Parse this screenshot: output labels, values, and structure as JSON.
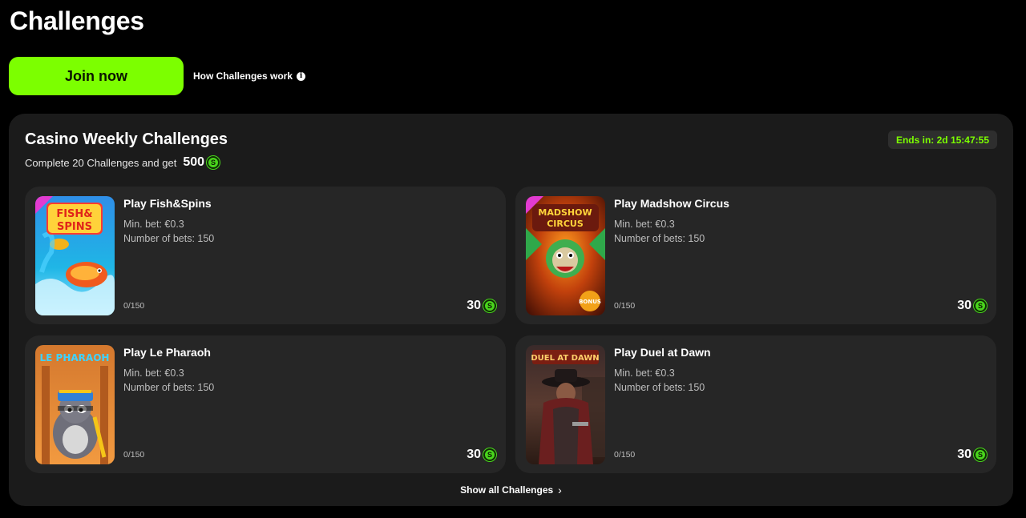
{
  "page": {
    "title": "Challenges"
  },
  "actions": {
    "join_label": "Join now",
    "how_label": "How Challenges work",
    "info_icon": "i"
  },
  "weekly": {
    "title": "Casino Weekly Challenges",
    "subtitle": "Complete 20 Challenges and get",
    "reward": "500",
    "coin_symbol": "S",
    "ends_in": "Ends in: 2d 15:47:55",
    "show_all": "Show all Challenges",
    "show_all_chevron": "›"
  },
  "challenges": [
    {
      "title": "Play Fish&Spins",
      "min_bet": "Min. bet: €0.3",
      "bets": "Number of bets: 150",
      "progress": "0/150",
      "reward": "30",
      "thumb_label": "FISH & SPINS",
      "thumb_icon": "fish-spins-game-thumbnail"
    },
    {
      "title": "Play Madshow Circus",
      "min_bet": "Min. bet: €0.3",
      "bets": "Number of bets: 150",
      "progress": "0/150",
      "reward": "30",
      "thumb_label": "MADSHOW CIRCUS",
      "thumb_icon": "madshow-circus-game-thumbnail"
    },
    {
      "title": "Play Le Pharaoh",
      "min_bet": "Min. bet: €0.3",
      "bets": "Number of bets: 150",
      "progress": "0/150",
      "reward": "30",
      "thumb_label": "LE PHARAOH",
      "thumb_icon": "le-pharaoh-game-thumbnail"
    },
    {
      "title": "Play Duel at Dawn",
      "min_bet": "Min. bet: €0.3",
      "bets": "Number of bets: 150",
      "progress": "0/150",
      "reward": "30",
      "thumb_label": "DUEL AT DAWN",
      "thumb_icon": "duel-at-dawn-game-thumbnail"
    }
  ],
  "colors": {
    "accent": "#7cff00",
    "coin": "#49d51c",
    "panel": "#1b1b1b",
    "card": "#262626"
  }
}
